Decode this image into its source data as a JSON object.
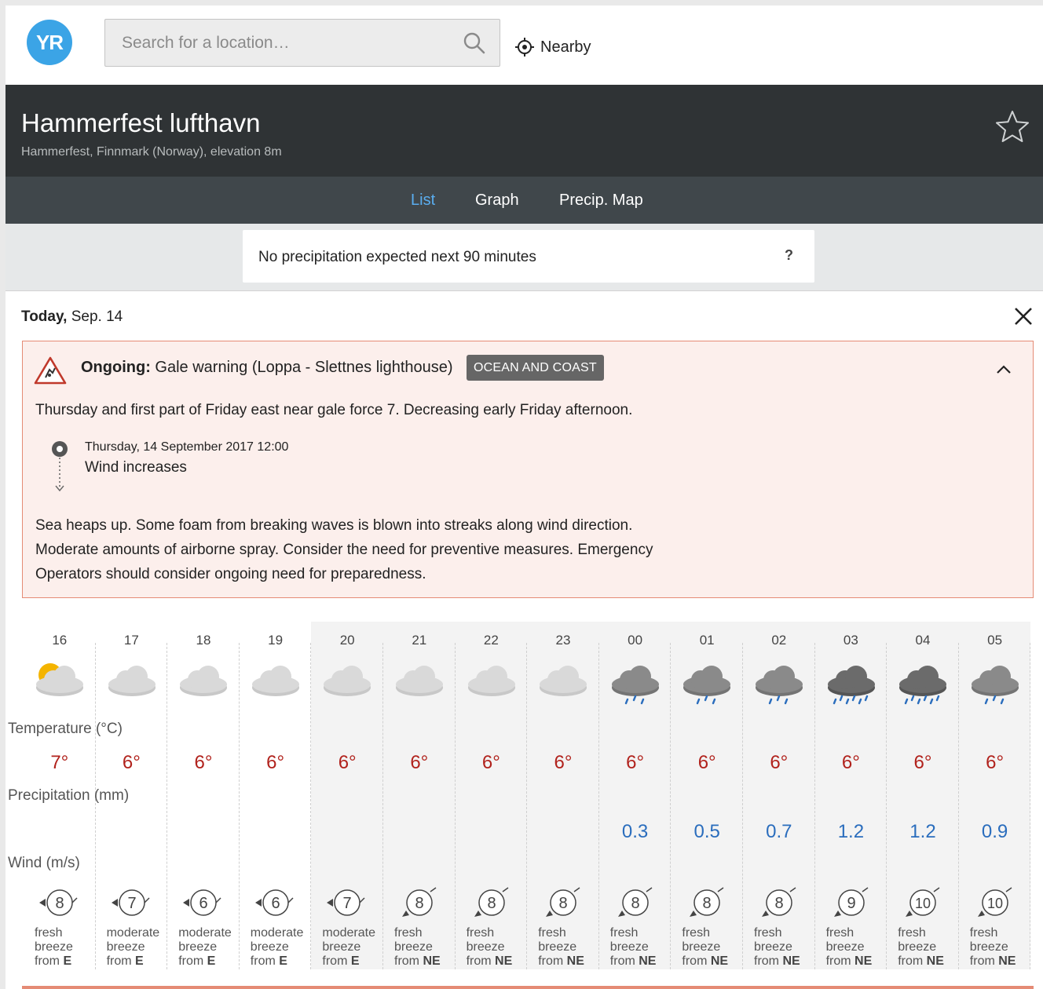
{
  "header": {
    "logo_text": "YR",
    "search_placeholder": "Search for a location…",
    "nearby_label": "Nearby"
  },
  "location": {
    "title": "Hammerfest lufthavn",
    "subtitle": "Hammerfest, Finnmark (Norway), elevation 8m"
  },
  "tabs": [
    {
      "label": "List",
      "active": true
    },
    {
      "label": "Graph",
      "active": false
    },
    {
      "label": "Precip. Map",
      "active": false
    }
  ],
  "nowcast": {
    "text": "No precipitation expected next 90 minutes",
    "help": "?"
  },
  "day": {
    "bold": "Today,",
    "date": "Sep. 14"
  },
  "warning": {
    "status": "Ongoing:",
    "title": "Gale warning (Loppa - Slettnes lighthouse)",
    "badge": "OCEAN AND COAST",
    "description": "Thursday and first part of Friday east near gale force 7. Decreasing early Friday afternoon.",
    "event_date": "Thursday, 14 September 2017 12:00",
    "event_text": "Wind increases",
    "consequences": [
      "Sea heaps up. Some foam from breaking waves is blown into streaks along wind direction.",
      "Moderate amounts of airborne spray. Consider the need for preventive measures. Emergency",
      "Operators should consider ongoing need for preparedness."
    ]
  },
  "labels": {
    "temperature": "Temperature (°C)",
    "precipitation": "Precipitation (mm)",
    "wind": "Wind (m/s)"
  },
  "colors": {
    "temp": "#b1221c",
    "precip": "#2a6dbd",
    "warning_border": "#e58b75"
  },
  "hours": [
    {
      "hour": "16",
      "icon": "partly-cloudy-sun-icon",
      "temp": "7°",
      "precip": "",
      "wind": "8",
      "wind_dir": "E",
      "wind_l1": "fresh",
      "wind_l2": "breeze",
      "shaded": false
    },
    {
      "hour": "17",
      "icon": "cloud-icon",
      "temp": "6°",
      "precip": "",
      "wind": "7",
      "wind_dir": "E",
      "wind_l1": "moderate",
      "wind_l2": "breeze",
      "shaded": false
    },
    {
      "hour": "18",
      "icon": "cloud-icon",
      "temp": "6°",
      "precip": "",
      "wind": "6",
      "wind_dir": "E",
      "wind_l1": "moderate",
      "wind_l2": "breeze",
      "shaded": false
    },
    {
      "hour": "19",
      "icon": "cloud-icon",
      "temp": "6°",
      "precip": "",
      "wind": "6",
      "wind_dir": "E",
      "wind_l1": "moderate",
      "wind_l2": "breeze",
      "shaded": false
    },
    {
      "hour": "20",
      "icon": "cloud-icon",
      "temp": "6°",
      "precip": "",
      "wind": "7",
      "wind_dir": "E",
      "wind_l1": "moderate",
      "wind_l2": "breeze",
      "shaded": true
    },
    {
      "hour": "21",
      "icon": "cloud-icon",
      "temp": "6°",
      "precip": "",
      "wind": "8",
      "wind_dir": "NE",
      "wind_l1": "fresh",
      "wind_l2": "breeze",
      "shaded": true
    },
    {
      "hour": "22",
      "icon": "cloud-icon",
      "temp": "6°",
      "precip": "",
      "wind": "8",
      "wind_dir": "NE",
      "wind_l1": "fresh",
      "wind_l2": "breeze",
      "shaded": true
    },
    {
      "hour": "23",
      "icon": "cloud-icon",
      "temp": "6°",
      "precip": "",
      "wind": "8",
      "wind_dir": "NE",
      "wind_l1": "fresh",
      "wind_l2": "breeze",
      "shaded": true
    },
    {
      "hour": "00",
      "icon": "light-rain-icon",
      "temp": "6°",
      "precip": "0.3",
      "wind": "8",
      "wind_dir": "NE",
      "wind_l1": "fresh",
      "wind_l2": "breeze",
      "shaded": true
    },
    {
      "hour": "01",
      "icon": "light-rain-icon",
      "temp": "6°",
      "precip": "0.5",
      "wind": "8",
      "wind_dir": "NE",
      "wind_l1": "fresh",
      "wind_l2": "breeze",
      "shaded": true
    },
    {
      "hour": "02",
      "icon": "light-rain-icon",
      "temp": "6°",
      "precip": "0.7",
      "wind": "8",
      "wind_dir": "NE",
      "wind_l1": "fresh",
      "wind_l2": "breeze",
      "shaded": true
    },
    {
      "hour": "03",
      "icon": "rain-icon",
      "temp": "6°",
      "precip": "1.2",
      "wind": "9",
      "wind_dir": "NE",
      "wind_l1": "fresh",
      "wind_l2": "breeze",
      "shaded": true
    },
    {
      "hour": "04",
      "icon": "rain-icon",
      "temp": "6°",
      "precip": "1.2",
      "wind": "10",
      "wind_dir": "NE",
      "wind_l1": "fresh",
      "wind_l2": "breeze",
      "shaded": true
    },
    {
      "hour": "05",
      "icon": "light-rain-icon",
      "temp": "6°",
      "precip": "0.9",
      "wind": "10",
      "wind_dir": "NE",
      "wind_l1": "fresh",
      "wind_l2": "breeze",
      "shaded": true
    }
  ]
}
